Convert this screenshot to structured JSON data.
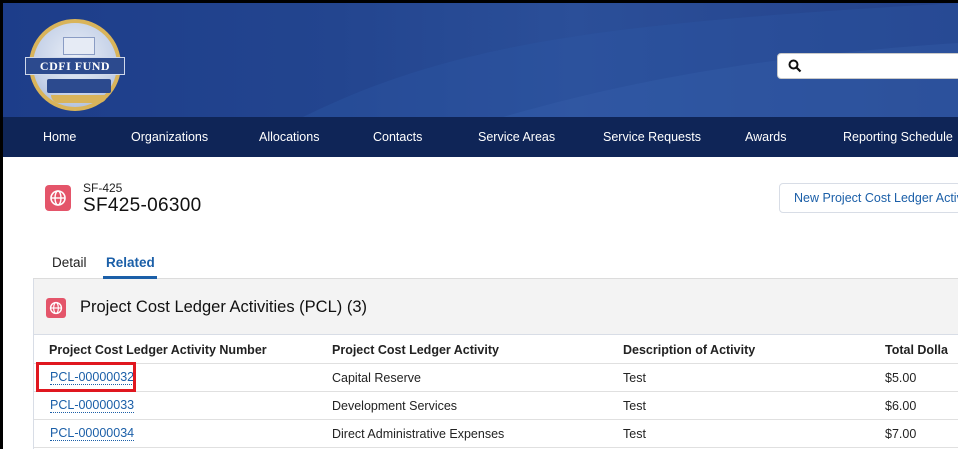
{
  "header": {
    "logo_text": "CDFI FUND",
    "search": {
      "placeholder": "",
      "value": ""
    }
  },
  "nav": {
    "items": [
      "Home",
      "Organizations",
      "Allocations",
      "Contacts",
      "Service Areas",
      "Service Requests",
      "Awards",
      "Reporting Schedule"
    ]
  },
  "record": {
    "type_label": "SF-425",
    "name": "SF425-06300",
    "new_button_label": "New Project Cost Ledger Activity"
  },
  "tabs": {
    "detail": "Detail",
    "related": "Related",
    "active": "Related"
  },
  "related_list": {
    "title": "Project Cost Ledger Activities (PCL) (3)",
    "columns": [
      "Project Cost Ledger Activity Number",
      "Project Cost Ledger Activity",
      "Description of Activity",
      "Total Dolla"
    ],
    "rows": [
      {
        "number": "PCL-00000032",
        "activity": "Capital Reserve",
        "description": "Test",
        "total": "$5.00"
      },
      {
        "number": "PCL-00000033",
        "activity": "Development Services",
        "description": "Test",
        "total": "$6.00"
      },
      {
        "number": "PCL-00000034",
        "activity": "Direct Administrative Expenses",
        "description": "Test",
        "total": "$7.00"
      }
    ]
  },
  "colors": {
    "header_bg": "#23458f",
    "nav_bg": "#0f2557",
    "link": "#1b5fa8",
    "record_icon": "#e4556a",
    "highlight_box": "#e0171f"
  },
  "icons": {
    "search": "search-icon",
    "record": "globe-icon"
  }
}
